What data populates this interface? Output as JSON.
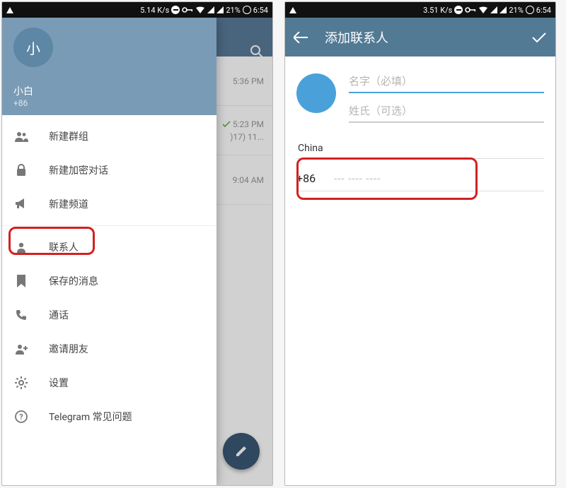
{
  "statusbar": {
    "speed_left": "5.14 K/s",
    "speed_right": "3.51 K/s",
    "battery": "21%",
    "time": "6:54"
  },
  "phone1": {
    "chat_times": [
      "5:36 PM",
      "5:23 PM",
      "9:04 AM"
    ],
    "chat_snippet": ")17) 11...",
    "drawer": {
      "avatar_initial": "小",
      "user_name": "小白",
      "user_phone": "+86",
      "items": [
        {
          "icon": "group",
          "label": "新建群组"
        },
        {
          "icon": "lock",
          "label": "新建加密对话"
        },
        {
          "icon": "megaphone",
          "label": "新建频道"
        },
        {
          "icon": "person",
          "label": "联系人"
        },
        {
          "icon": "bookmark",
          "label": "保存的消息"
        },
        {
          "icon": "phone",
          "label": "通话"
        },
        {
          "icon": "invite",
          "label": "邀请朋友"
        },
        {
          "icon": "gear",
          "label": "设置"
        },
        {
          "icon": "help",
          "label": "Telegram 常见问题"
        }
      ]
    }
  },
  "phone2": {
    "appbar_title": "添加联系人",
    "first_name_placeholder": "名字（必填）",
    "last_name_placeholder": "姓氏（可选）",
    "country": "China",
    "country_code": "+86",
    "phone_placeholder": "--- ---- ----"
  }
}
